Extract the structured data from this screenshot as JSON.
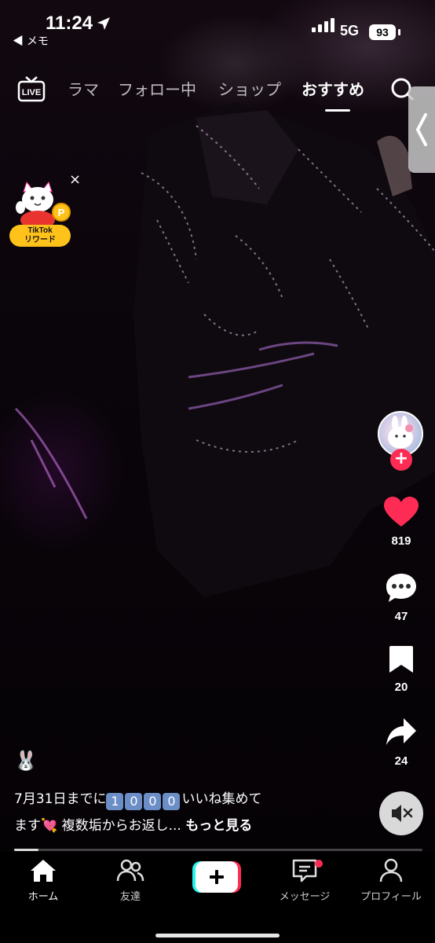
{
  "status_bar": {
    "time": "11:24",
    "back_app": "◀ メモ",
    "network": "5G",
    "battery": "93"
  },
  "top_nav": {
    "live_label": "LIVE",
    "tabs": [
      {
        "label": "ラマ",
        "active": false
      },
      {
        "label": "フォロー中",
        "active": false
      },
      {
        "label": "ショップ",
        "active": false
      },
      {
        "label": "おすすめ",
        "active": true
      }
    ]
  },
  "reward": {
    "line1": "TikTok",
    "line2": "リワード",
    "close": "×"
  },
  "actions": {
    "likes": "819",
    "comments": "47",
    "saves": "20",
    "shares": "24"
  },
  "caption": {
    "emoji": "🐰",
    "part1": "7月31日までに",
    "digits": [
      "1",
      "0",
      "0",
      "0"
    ],
    "part2": "いいね集めて",
    "part3": "ます",
    "heart_emoji": "💘",
    "part4": " 複数垢からお返し... ",
    "more": "もっと見る"
  },
  "video_progress": 0.06,
  "bottom_nav": [
    {
      "label": "ホーム",
      "icon": "home-icon",
      "active": true
    },
    {
      "label": "友達",
      "icon": "friends-icon",
      "active": false
    },
    {
      "label": "",
      "icon": "create-icon",
      "active": false
    },
    {
      "label": "メッセージ",
      "icon": "message-icon",
      "active": false
    },
    {
      "label": "プロフィール",
      "icon": "profile-icon",
      "active": false
    }
  ],
  "colors": {
    "accent_red": "#fe2c55",
    "like_red": "#fe2c55",
    "reward_yellow": "#ffc21a",
    "create_cyan": "#25f4ee"
  }
}
